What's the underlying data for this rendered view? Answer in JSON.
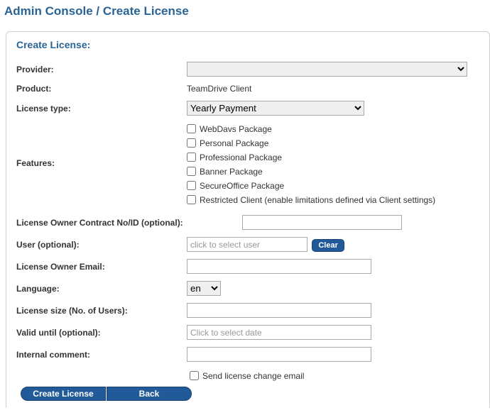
{
  "page_title": "Admin Console / Create License",
  "panel_title": "Create License:",
  "labels": {
    "provider": "Provider:",
    "product": "Product:",
    "license_type": "License type:",
    "features": "Features:",
    "contract": "License Owner Contract No/ID (optional):",
    "user": "User (optional):",
    "owner_email": "License Owner Email:",
    "language": "Language:",
    "license_size": "License size (No. of Users):",
    "valid_until": "Valid until (optional):",
    "internal_comment": "Internal comment:"
  },
  "values": {
    "provider_selected": "",
    "product": "TeamDrive Client",
    "license_type_selected": "Yearly Payment",
    "language_selected": "en",
    "contract": "",
    "owner_email": "",
    "license_size": "",
    "internal_comment": ""
  },
  "placeholders": {
    "user": "click to select user",
    "valid_until": "Click to select date"
  },
  "features": [
    "WebDavs Package",
    "Personal Package",
    "Professional Package",
    "Banner Package",
    "SecureOffice Package",
    "Restricted Client (enable limitations defined via Client settings)"
  ],
  "buttons": {
    "clear": "Clear",
    "create": "Create License",
    "back": "Back"
  },
  "checkbox_labels": {
    "send_change_email": "Send license change email"
  }
}
